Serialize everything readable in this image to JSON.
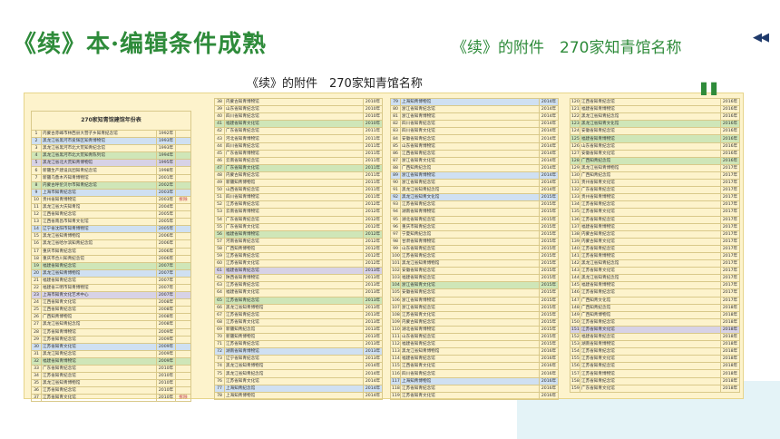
{
  "header": {
    "main_title": "《续》本·编辑条件成熟",
    "right_title": "《续》的附件　270家知青馆名称",
    "nav_icons": "◀◀"
  },
  "subtitle": "《续》的附件　270家知青馆名称",
  "quote_mark": "\"",
  "sheet_title": "270家知青馆建馆年份表",
  "columns": [
    {
      "rows": [
        {
          "n": "1",
          "name": "内蒙古赤峰市林西县大营子乡知青纪念馆",
          "y": "1992年",
          "m": "",
          "t": ""
        },
        {
          "n": "2",
          "name": "黑龙江省黑河市爱辉区知青博物馆",
          "y": "1993年",
          "m": "",
          "t": "b"
        },
        {
          "n": "3",
          "name": "黑龙江省黑河市北大荒知青纪念馆",
          "y": "1993年",
          "m": "",
          "t": ""
        },
        {
          "n": "4",
          "name": "黑龙江省黑河市北大荒知青陈列馆",
          "y": "1994年",
          "m": "",
          "t": "g"
        },
        {
          "n": "5",
          "name": "黑龙江省北大荒知青博物馆",
          "y": "1995年",
          "m": "",
          "t": "p"
        },
        {
          "n": "6",
          "name": "新疆生产建设兵团知青纪念馆",
          "y": "1998年",
          "m": "",
          "t": ""
        },
        {
          "n": "7",
          "name": "新疆乌鲁木齐知青博物馆",
          "y": "2001年",
          "m": "",
          "t": ""
        },
        {
          "n": "8",
          "name": "内蒙古呼伦贝尔市知青纪念馆",
          "y": "2002年",
          "m": "",
          "t": "g"
        },
        {
          "n": "9",
          "name": "上海市知青纪念馆",
          "y": "2003年",
          "m": "",
          "t": "b"
        },
        {
          "n": "10",
          "name": "贵州省知青博物馆",
          "y": "2003年",
          "m": "拆除",
          "t": ""
        },
        {
          "n": "11",
          "name": "黑龙江省大庆知青馆",
          "y": "2004年",
          "m": "",
          "t": ""
        },
        {
          "n": "12",
          "name": "江西省知青纪念馆",
          "y": "2005年",
          "m": "",
          "t": ""
        },
        {
          "n": "13",
          "name": "江西省南昌市知青文化馆",
          "y": "2005年",
          "m": "",
          "t": ""
        },
        {
          "n": "14",
          "name": "辽宁省沈阳市知青博物馆",
          "y": "2005年",
          "m": "",
          "t": "b"
        },
        {
          "n": "15",
          "name": "黑龙江省知青博物馆",
          "y": "2006年",
          "m": "",
          "t": ""
        },
        {
          "n": "16",
          "name": "黑龙江省哈尔滨知青纪念馆",
          "y": "2006年",
          "m": "",
          "t": ""
        },
        {
          "n": "17",
          "name": "重庆市知青纪念馆",
          "y": "2006年",
          "m": "",
          "t": ""
        },
        {
          "n": "18",
          "name": "重庆市合川知青纪念馆",
          "y": "2006年",
          "m": "",
          "t": ""
        },
        {
          "n": "19",
          "name": "福建省知青纪念馆",
          "y": "2007年",
          "m": "",
          "t": "g"
        },
        {
          "n": "20",
          "name": "黑龙江省知青博物馆",
          "y": "2007年",
          "m": "",
          "t": "b"
        },
        {
          "n": "21",
          "name": "福建省知青纪念馆",
          "y": "2007年",
          "m": "",
          "t": ""
        },
        {
          "n": "22",
          "name": "福建省三明市知青博物馆",
          "y": "2007年",
          "m": "",
          "t": ""
        },
        {
          "n": "23",
          "name": "上海市知青文化艺术中心",
          "y": "2007年",
          "m": "",
          "t": "p"
        },
        {
          "n": "24",
          "name": "江西省知青文化馆",
          "y": "2008年",
          "m": "",
          "t": ""
        },
        {
          "n": "25",
          "name": "江西省知青纪念馆",
          "y": "2008年",
          "m": "",
          "t": ""
        },
        {
          "n": "26",
          "name": "广西知青博物馆",
          "y": "2008年",
          "m": "",
          "t": ""
        },
        {
          "n": "27",
          "name": "黑龙江省知青纪念馆",
          "y": "2008年",
          "m": "",
          "t": ""
        },
        {
          "n": "28",
          "name": "江苏省知青博物馆",
          "y": "2009年",
          "m": "",
          "t": ""
        },
        {
          "n": "29",
          "name": "江苏省知青纪念馆",
          "y": "2009年",
          "m": "",
          "t": ""
        },
        {
          "n": "30",
          "name": "江苏省知青文化馆",
          "y": "2009年",
          "m": "",
          "t": "b"
        },
        {
          "n": "31",
          "name": "黑龙江知青纪念馆",
          "y": "2009年",
          "m": "",
          "t": ""
        },
        {
          "n": "32",
          "name": "福建省知青博物馆",
          "y": "2009年",
          "m": "",
          "t": "g"
        },
        {
          "n": "33",
          "name": "广东省知青纪念馆",
          "y": "2010年",
          "m": "",
          "t": ""
        },
        {
          "n": "34",
          "name": "江苏省知青纪念馆",
          "y": "2010年",
          "m": "",
          "t": ""
        },
        {
          "n": "35",
          "name": "黑龙江省知青博物馆",
          "y": "2010年",
          "m": "",
          "t": ""
        },
        {
          "n": "36",
          "name": "江苏省知青纪念馆",
          "y": "2010年",
          "m": "",
          "t": ""
        },
        {
          "n": "37",
          "name": "江苏省知青文化馆",
          "y": "2010年",
          "m": "拆除",
          "t": ""
        }
      ]
    },
    {
      "rows": [
        {
          "n": "38",
          "name": "内蒙古知青博物馆",
          "y": "2010年",
          "t": ""
        },
        {
          "n": "39",
          "name": "山东省知青纪念馆",
          "y": "2010年",
          "t": ""
        },
        {
          "n": "40",
          "name": "四川省知青纪念馆",
          "y": "2010年",
          "t": ""
        },
        {
          "n": "41",
          "name": "福建省知青文化馆",
          "y": "2010年",
          "t": "g"
        },
        {
          "n": "42",
          "name": "广东省知青纪念馆",
          "y": "2011年",
          "t": ""
        },
        {
          "n": "43",
          "name": "河北省知青博物馆",
          "y": "2011年",
          "t": ""
        },
        {
          "n": "44",
          "name": "四川省知青纪念馆",
          "y": "2011年",
          "t": ""
        },
        {
          "n": "45",
          "name": "广东省知青博物馆",
          "y": "2011年",
          "t": ""
        },
        {
          "n": "46",
          "name": "云南省知青纪念馆",
          "y": "2011年",
          "t": ""
        },
        {
          "n": "47",
          "name": "广东省知青文化馆",
          "y": "2011年",
          "t": "g"
        },
        {
          "n": "48",
          "name": "内蒙古知青纪念馆",
          "y": "2011年",
          "t": ""
        },
        {
          "n": "49",
          "name": "新疆知青博物馆",
          "y": "2011年",
          "t": ""
        },
        {
          "n": "50",
          "name": "山西省知青纪念馆",
          "y": "2011年",
          "t": ""
        },
        {
          "n": "51",
          "name": "四川省知青博物馆",
          "y": "2011年",
          "t": ""
        },
        {
          "n": "52",
          "name": "江苏省知青纪念馆",
          "y": "2012年",
          "t": ""
        },
        {
          "n": "53",
          "name": "云南省知青博物馆",
          "y": "2012年",
          "t": ""
        },
        {
          "n": "54",
          "name": "广东省知青纪念馆",
          "y": "2012年",
          "t": ""
        },
        {
          "n": "55",
          "name": "广东省知青文化馆",
          "y": "2012年",
          "t": ""
        },
        {
          "n": "56",
          "name": "福建省知青博物馆",
          "y": "2012年",
          "t": "g"
        },
        {
          "n": "57",
          "name": "河南省知青纪念馆",
          "y": "2012年",
          "t": ""
        },
        {
          "n": "58",
          "name": "广西知青博物馆",
          "y": "2012年",
          "t": ""
        },
        {
          "n": "59",
          "name": "江苏省知青纪念馆",
          "y": "2012年",
          "t": ""
        },
        {
          "n": "60",
          "name": "江苏省知青文化馆",
          "y": "2012年",
          "t": ""
        },
        {
          "n": "61",
          "name": "福建省知青纪念馆",
          "y": "2013年",
          "t": "p"
        },
        {
          "n": "62",
          "name": "陕西省知青博物馆",
          "y": "2013年",
          "t": ""
        },
        {
          "n": "63",
          "name": "江苏省知青纪念馆",
          "y": "2013年",
          "t": ""
        },
        {
          "n": "64",
          "name": "福建省知青文化馆",
          "y": "2013年",
          "t": ""
        },
        {
          "n": "65",
          "name": "江苏省知青纪念馆",
          "y": "2013年",
          "t": "g"
        },
        {
          "n": "66",
          "name": "黑龙江省知青博物馆",
          "y": "2013年",
          "t": ""
        },
        {
          "n": "67",
          "name": "江苏省知青纪念馆",
          "y": "2013年",
          "t": ""
        },
        {
          "n": "68",
          "name": "江苏省知青文化馆",
          "y": "2013年",
          "t": ""
        },
        {
          "n": "69",
          "name": "新疆知青纪念馆",
          "y": "2013年",
          "t": ""
        },
        {
          "n": "70",
          "name": "新疆知青博物馆",
          "y": "2013年",
          "t": ""
        },
        {
          "n": "71",
          "name": "江苏省知青纪念馆",
          "y": "2013年",
          "t": ""
        },
        {
          "n": "72",
          "name": "湖南省知青博物馆",
          "y": "2013年",
          "t": "b"
        },
        {
          "n": "73",
          "name": "辽宁省知青纪念馆",
          "y": "2013年",
          "t": ""
        },
        {
          "n": "74",
          "name": "黑龙江省知青博物馆",
          "y": "2014年",
          "t": ""
        },
        {
          "n": "75",
          "name": "黑龙江省知青纪念馆",
          "y": "2014年",
          "t": ""
        },
        {
          "n": "76",
          "name": "江苏省知青文化馆",
          "y": "2014年",
          "t": ""
        },
        {
          "n": "77",
          "name": "上海知青纪念馆",
          "y": "2014年",
          "t": "b"
        },
        {
          "n": "78",
          "name": "上海知青博物馆",
          "y": "2014年",
          "t": ""
        }
      ]
    },
    {
      "rows": [
        {
          "n": "79",
          "name": "上海知青博物馆",
          "y": "2014年",
          "t": "b"
        },
        {
          "n": "80",
          "name": "浙江省知青纪念馆",
          "y": "2014年",
          "t": ""
        },
        {
          "n": "81",
          "name": "浙江省知青博物馆",
          "y": "2014年",
          "t": ""
        },
        {
          "n": "82",
          "name": "四川省知青纪念馆",
          "y": "2014年",
          "t": ""
        },
        {
          "n": "83",
          "name": "四川省知青文化馆",
          "y": "2014年",
          "t": ""
        },
        {
          "n": "84",
          "name": "安徽省知青纪念馆",
          "y": "2014年",
          "t": ""
        },
        {
          "n": "85",
          "name": "山东省知青博物馆",
          "y": "2014年",
          "t": ""
        },
        {
          "n": "86",
          "name": "江西省知青纪念馆",
          "y": "2014年",
          "t": ""
        },
        {
          "n": "87",
          "name": "浙江省知青文化馆",
          "y": "2014年",
          "t": ""
        },
        {
          "n": "88",
          "name": "广西知青纪念馆",
          "y": "2014年",
          "t": ""
        },
        {
          "n": "89",
          "name": "浙江省知青博物馆",
          "y": "2014年",
          "t": "b"
        },
        {
          "n": "90",
          "name": "浙江省知青纪念馆",
          "y": "2014年",
          "t": ""
        },
        {
          "n": "91",
          "name": "黑龙江省知青纪念馆",
          "y": "2014年",
          "t": ""
        },
        {
          "n": "92",
          "name": "黑龙江省知青文化馆",
          "y": "2015年",
          "t": "b"
        },
        {
          "n": "93",
          "name": "江苏省知青纪念馆",
          "y": "2015年",
          "t": ""
        },
        {
          "n": "94",
          "name": "湖南省知青博物馆",
          "y": "2015年",
          "t": ""
        },
        {
          "n": "95",
          "name": "湖北省知青纪念馆",
          "y": "2015年",
          "t": ""
        },
        {
          "n": "96",
          "name": "重庆市知青纪念馆",
          "y": "2015年",
          "t": ""
        },
        {
          "n": "97",
          "name": "宁夏知青纪念馆",
          "y": "2015年",
          "t": ""
        },
        {
          "n": "98",
          "name": "甘肃省知青博物馆",
          "y": "2015年",
          "t": ""
        },
        {
          "n": "99",
          "name": "山东省知青纪念馆",
          "y": "2015年",
          "t": ""
        },
        {
          "n": "100",
          "name": "江苏省知青纪念馆",
          "y": "2015年",
          "t": ""
        },
        {
          "n": "101",
          "name": "黑龙江省知青博物馆",
          "y": "2015年",
          "t": ""
        },
        {
          "n": "102",
          "name": "安徽省知青纪念馆",
          "y": "2015年",
          "t": ""
        },
        {
          "n": "103",
          "name": "福建省知青纪念馆",
          "y": "2015年",
          "t": ""
        },
        {
          "n": "104",
          "name": "浙江省知青文化馆",
          "y": "2015年",
          "t": "g"
        },
        {
          "n": "105",
          "name": "安徽省知青纪念馆",
          "y": "2015年",
          "t": ""
        },
        {
          "n": "106",
          "name": "浙江省知青博物馆",
          "y": "2015年",
          "t": ""
        },
        {
          "n": "107",
          "name": "浙江省知青纪念馆",
          "y": "2015年",
          "t": ""
        },
        {
          "n": "108",
          "name": "江苏省知青文化馆",
          "y": "2015年",
          "t": ""
        },
        {
          "n": "109",
          "name": "内蒙古知青纪念馆",
          "y": "2015年",
          "t": ""
        },
        {
          "n": "110",
          "name": "湖北省知青博物馆",
          "y": "2015年",
          "t": ""
        },
        {
          "n": "111",
          "name": "山东省知青纪念馆",
          "y": "2015年",
          "t": ""
        },
        {
          "n": "112",
          "name": "福建省知青纪念馆",
          "y": "2015年",
          "t": ""
        },
        {
          "n": "113",
          "name": "黑龙江省知青博物馆",
          "y": "2016年",
          "t": ""
        },
        {
          "n": "114",
          "name": "福建省知青纪念馆",
          "y": "2016年",
          "t": ""
        },
        {
          "n": "115",
          "name": "江西省知青文化馆",
          "y": "2016年",
          "t": ""
        },
        {
          "n": "116",
          "name": "四川省知青纪念馆",
          "y": "2016年",
          "t": ""
        },
        {
          "n": "117",
          "name": "上海知青博物馆",
          "y": "2016年",
          "t": "b"
        },
        {
          "n": "118",
          "name": "江苏省知青纪念馆",
          "y": "2016年",
          "t": ""
        },
        {
          "n": "119",
          "name": "江苏省知青文化馆",
          "y": "2016年",
          "t": ""
        }
      ]
    },
    {
      "rows": [
        {
          "n": "120",
          "name": "江西省知青纪念馆",
          "y": "2016年",
          "t": ""
        },
        {
          "n": "121",
          "name": "福建省知青博物馆",
          "y": "2016年",
          "t": ""
        },
        {
          "n": "122",
          "name": "黑龙江省知青纪念馆",
          "y": "2016年",
          "t": ""
        },
        {
          "n": "123",
          "name": "黑龙江省知青文化馆",
          "y": "2016年",
          "t": "g"
        },
        {
          "n": "124",
          "name": "安徽省知青纪念馆",
          "y": "2016年",
          "t": ""
        },
        {
          "n": "125",
          "name": "福建省知青博物馆",
          "y": "2016年",
          "t": "g"
        },
        {
          "n": "126",
          "name": "山东省知青纪念馆",
          "y": "2016年",
          "t": ""
        },
        {
          "n": "127",
          "name": "安徽省知青文化馆",
          "y": "2016年",
          "t": ""
        },
        {
          "n": "128",
          "name": "广西知青纪念馆",
          "y": "2016年",
          "t": "g"
        },
        {
          "n": "129",
          "name": "黑龙江省知青博物馆",
          "y": "2017年",
          "t": ""
        },
        {
          "n": "130",
          "name": "广西知青纪念馆",
          "y": "2017年",
          "t": ""
        },
        {
          "n": "131",
          "name": "贵州省知青文化馆",
          "y": "2017年",
          "t": ""
        },
        {
          "n": "132",
          "name": "广东省知青纪念馆",
          "y": "2017年",
          "t": ""
        },
        {
          "n": "133",
          "name": "贵州省知青博物馆",
          "y": "2017年",
          "t": ""
        },
        {
          "n": "134",
          "name": "江苏省知青纪念馆",
          "y": "2017年",
          "t": ""
        },
        {
          "n": "135",
          "name": "江苏省知青文化馆",
          "y": "2017年",
          "t": ""
        },
        {
          "n": "136",
          "name": "江苏省知青纪念馆",
          "y": "2017年",
          "t": ""
        },
        {
          "n": "137",
          "name": "福建省知青博物馆",
          "y": "2017年",
          "t": ""
        },
        {
          "n": "138",
          "name": "内蒙古知青纪念馆",
          "y": "2017年",
          "t": ""
        },
        {
          "n": "139",
          "name": "内蒙古知青文化馆",
          "y": "2017年",
          "t": ""
        },
        {
          "n": "140",
          "name": "江苏省知青纪念馆",
          "y": "2017年",
          "t": ""
        },
        {
          "n": "141",
          "name": "江苏省知青博物馆",
          "y": "2017年",
          "t": ""
        },
        {
          "n": "142",
          "name": "黑龙江省知青纪念馆",
          "y": "2017年",
          "t": ""
        },
        {
          "n": "143",
          "name": "江苏省知青文化馆",
          "y": "2017年",
          "t": ""
        },
        {
          "n": "144",
          "name": "黑龙江省知青纪念馆",
          "y": "2017年",
          "t": ""
        },
        {
          "n": "145",
          "name": "福建省知青博物馆",
          "y": "2017年",
          "t": ""
        },
        {
          "n": "146",
          "name": "江苏省知青纪念馆",
          "y": "2017年",
          "t": ""
        },
        {
          "n": "147",
          "name": "广西知青文化馆",
          "y": "2017年",
          "t": ""
        },
        {
          "n": "148",
          "name": "广西知青纪念馆",
          "y": "2018年",
          "t": ""
        },
        {
          "n": "149",
          "name": "广西知青博物馆",
          "y": "2018年",
          "t": ""
        },
        {
          "n": "150",
          "name": "江苏省知青纪念馆",
          "y": "2018年",
          "t": ""
        },
        {
          "n": "151",
          "name": "江苏省知青文化馆",
          "y": "2018年",
          "t": "p"
        },
        {
          "n": "152",
          "name": "福建省知青纪念馆",
          "y": "2018年",
          "t": ""
        },
        {
          "n": "153",
          "name": "湖南省知青博物馆",
          "y": "2018年",
          "t": ""
        },
        {
          "n": "154",
          "name": "江苏省知青纪念馆",
          "y": "2018年",
          "t": ""
        },
        {
          "n": "155",
          "name": "江苏省知青文化馆",
          "y": "2018年",
          "t": ""
        },
        {
          "n": "156",
          "name": "江苏省知青纪念馆",
          "y": "2018年",
          "t": ""
        },
        {
          "n": "157",
          "name": "江苏省知青博物馆",
          "y": "2018年",
          "t": ""
        },
        {
          "n": "158",
          "name": "江苏省知青纪念馆",
          "y": "2018年",
          "t": ""
        },
        {
          "n": "159",
          "name": "广东省知青文化馆",
          "y": "2018年",
          "t": ""
        }
      ]
    }
  ]
}
